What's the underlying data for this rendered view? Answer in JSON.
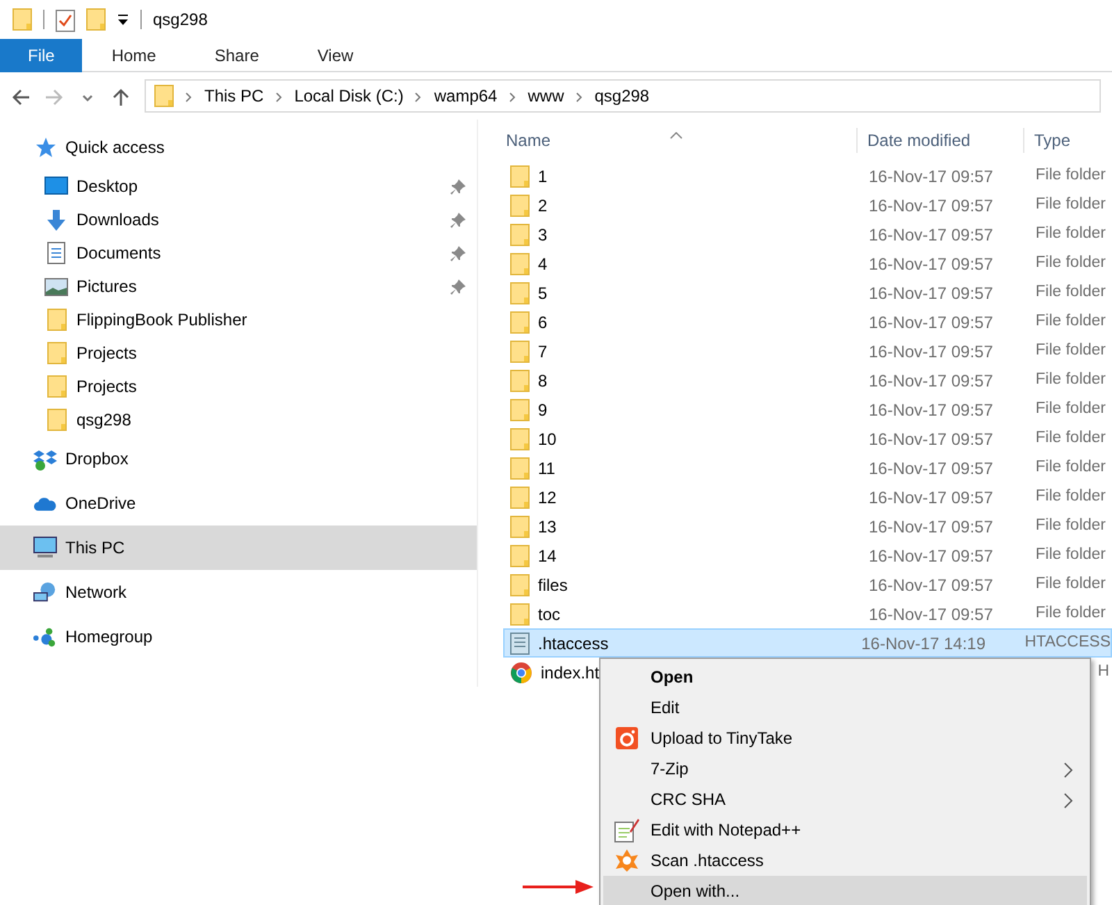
{
  "window": {
    "title": "qsg298"
  },
  "ribbon_tabs": [
    {
      "label": "File",
      "selected": true
    },
    {
      "label": "Home",
      "selected": false
    },
    {
      "label": "Share",
      "selected": false
    },
    {
      "label": "View",
      "selected": false
    }
  ],
  "address_bar": {
    "path": [
      "This PC",
      "Local Disk (C:)",
      "wamp64",
      "www",
      "qsg298"
    ]
  },
  "sidebar": {
    "items": [
      {
        "label": "Quick access",
        "kind": "star",
        "selected": false,
        "children": [
          {
            "label": "Desktop",
            "kind": "desktop",
            "pinned": true,
            "selected": false
          },
          {
            "label": "Downloads",
            "kind": "download",
            "pinned": true,
            "selected": false
          },
          {
            "label": "Documents",
            "kind": "document",
            "pinned": true,
            "selected": false
          },
          {
            "label": "Pictures",
            "kind": "pictures",
            "pinned": true,
            "selected": false
          },
          {
            "label": "FlippingBook Publisher",
            "kind": "folder",
            "pinned": false,
            "selected": false
          },
          {
            "label": "Projects",
            "kind": "folder",
            "pinned": false,
            "selected": false
          },
          {
            "label": "Projects",
            "kind": "folder",
            "pinned": false,
            "selected": false
          },
          {
            "label": "qsg298",
            "kind": "folder",
            "pinned": false,
            "selected": false
          }
        ]
      },
      {
        "label": "Dropbox",
        "kind": "dropbox",
        "selected": false
      },
      {
        "label": "OneDrive",
        "kind": "cloud",
        "selected": false
      },
      {
        "label": "This PC",
        "kind": "pc",
        "selected": true
      },
      {
        "label": "Network",
        "kind": "network",
        "selected": false
      },
      {
        "label": "Homegroup",
        "kind": "homegroup",
        "selected": false
      }
    ]
  },
  "file_list": {
    "columns": [
      "Name",
      "Date modified",
      "Type"
    ],
    "rows": [
      {
        "name": "1",
        "date": "16-Nov-17 09:57",
        "type": "File folder",
        "kind": "folder",
        "selected": false
      },
      {
        "name": "2",
        "date": "16-Nov-17 09:57",
        "type": "File folder",
        "kind": "folder",
        "selected": false
      },
      {
        "name": "3",
        "date": "16-Nov-17 09:57",
        "type": "File folder",
        "kind": "folder",
        "selected": false
      },
      {
        "name": "4",
        "date": "16-Nov-17 09:57",
        "type": "File folder",
        "kind": "folder",
        "selected": false
      },
      {
        "name": "5",
        "date": "16-Nov-17 09:57",
        "type": "File folder",
        "kind": "folder",
        "selected": false
      },
      {
        "name": "6",
        "date": "16-Nov-17 09:57",
        "type": "File folder",
        "kind": "folder",
        "selected": false
      },
      {
        "name": "7",
        "date": "16-Nov-17 09:57",
        "type": "File folder",
        "kind": "folder",
        "selected": false
      },
      {
        "name": "8",
        "date": "16-Nov-17 09:57",
        "type": "File folder",
        "kind": "folder",
        "selected": false
      },
      {
        "name": "9",
        "date": "16-Nov-17 09:57",
        "type": "File folder",
        "kind": "folder",
        "selected": false
      },
      {
        "name": "10",
        "date": "16-Nov-17 09:57",
        "type": "File folder",
        "kind": "folder",
        "selected": false
      },
      {
        "name": "11",
        "date": "16-Nov-17 09:57",
        "type": "File folder",
        "kind": "folder",
        "selected": false
      },
      {
        "name": "12",
        "date": "16-Nov-17 09:57",
        "type": "File folder",
        "kind": "folder",
        "selected": false
      },
      {
        "name": "13",
        "date": "16-Nov-17 09:57",
        "type": "File folder",
        "kind": "folder",
        "selected": false
      },
      {
        "name": "14",
        "date": "16-Nov-17 09:57",
        "type": "File folder",
        "kind": "folder",
        "selected": false
      },
      {
        "name": "files",
        "date": "16-Nov-17 09:57",
        "type": "File folder",
        "kind": "folder",
        "selected": false
      },
      {
        "name": "toc",
        "date": "16-Nov-17 09:57",
        "type": "File folder",
        "kind": "folder",
        "selected": false
      },
      {
        "name": ".htaccess",
        "date": "16-Nov-17 14:19",
        "type": "HTACCESS",
        "kind": "textfile",
        "selected": true
      },
      {
        "name": "index.ht",
        "type": "H",
        "kind": "chrome",
        "selected": false
      }
    ]
  },
  "context_menu": {
    "items": [
      {
        "label": "Open",
        "bold": true,
        "selected": false
      },
      {
        "label": "Edit",
        "selected": false
      },
      {
        "label": "Upload to TinyTake",
        "kind": "camera",
        "selected": false
      },
      {
        "label": "7-Zip",
        "submenu": true,
        "selected": false
      },
      {
        "label": "CRC SHA",
        "submenu": true,
        "selected": false
      },
      {
        "label": "Edit with Notepad++",
        "kind": "notepad",
        "selected": false
      },
      {
        "label": "Scan .htaccess",
        "kind": "shield",
        "selected": false
      },
      {
        "label": "Open with...",
        "selected": true
      }
    ]
  }
}
